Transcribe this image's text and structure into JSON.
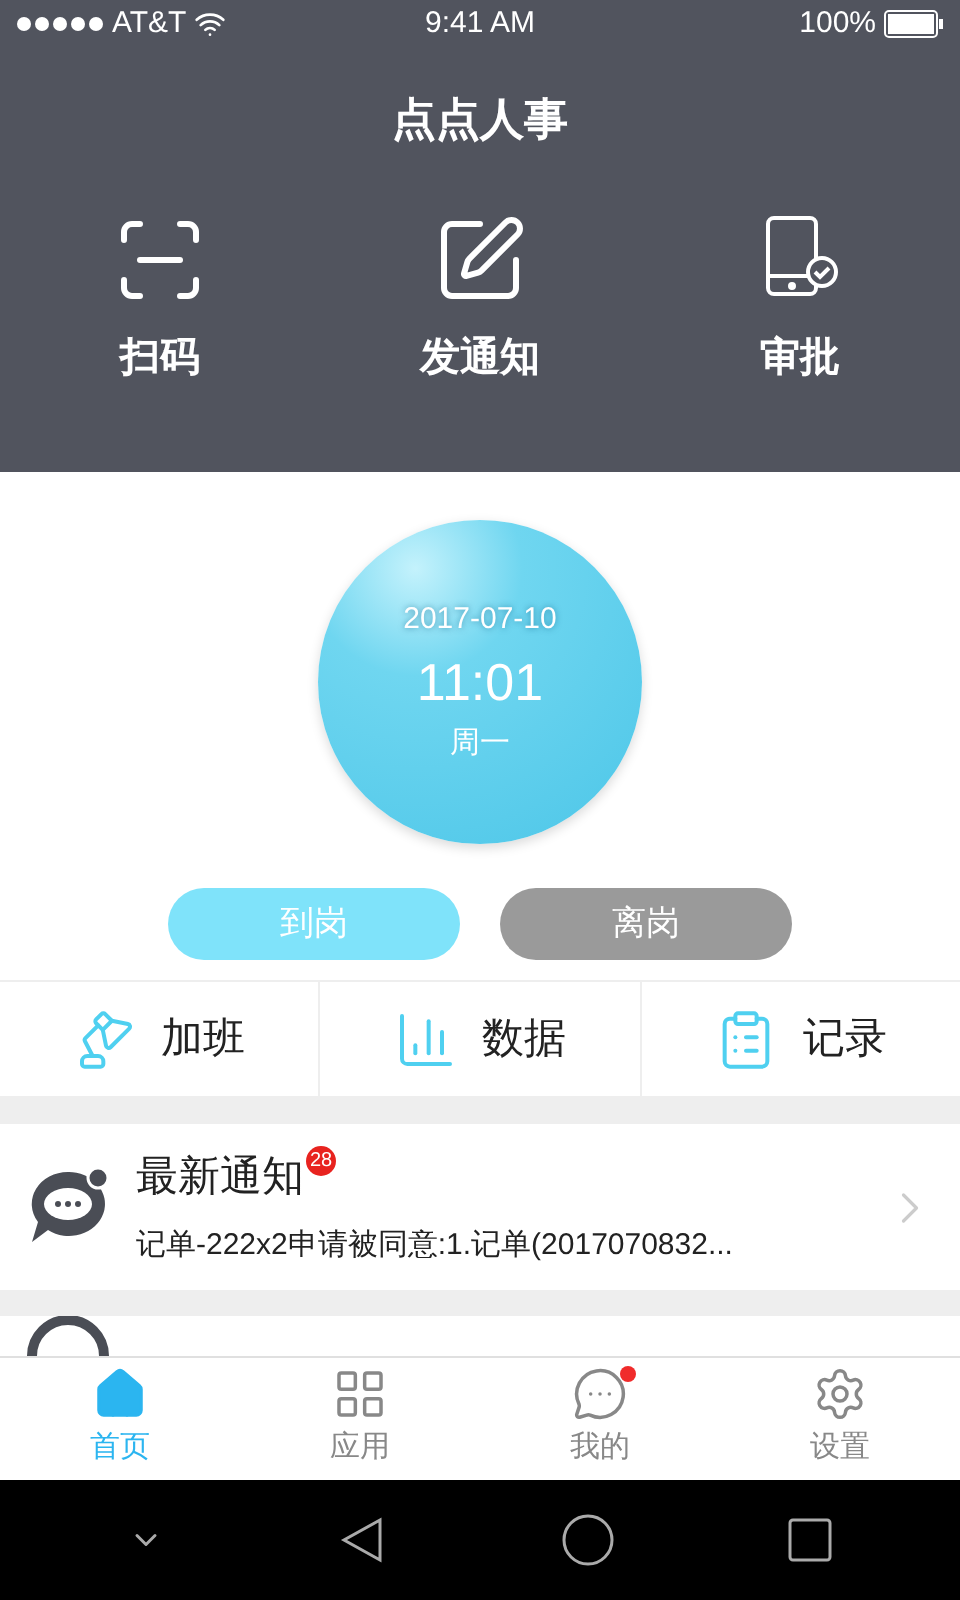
{
  "status_bar": {
    "carrier": "AT&T",
    "time": "9:41 AM",
    "battery": "100%"
  },
  "header": {
    "title": "点点人事",
    "actions": [
      {
        "label": "扫码",
        "kind": "scan"
      },
      {
        "label": "发通知",
        "kind": "compose"
      },
      {
        "label": "审批",
        "kind": "approve"
      }
    ]
  },
  "clock": {
    "date": "2017-07-10",
    "time": "11:01",
    "weekday": "周一"
  },
  "buttons": [
    {
      "label": "到岗",
      "disabled": false
    },
    {
      "label": "离岗",
      "disabled": true
    }
  ],
  "shortcuts": [
    {
      "label": "加班",
      "kind": "lamp"
    },
    {
      "label": "数据",
      "kind": "chart"
    },
    {
      "label": "记录",
      "kind": "clipboard"
    }
  ],
  "notification": {
    "title": "最新通知",
    "badge": "28",
    "text": "记单-222x2申请被同意:1.记单(2017070832..."
  },
  "tabs": [
    {
      "label": "首页",
      "kind": "home",
      "selected": true,
      "dot": false
    },
    {
      "label": "应用",
      "kind": "apps",
      "selected": false,
      "dot": false
    },
    {
      "label": "我的",
      "kind": "chat",
      "selected": false,
      "dot": true
    },
    {
      "label": "设置",
      "kind": "settings",
      "selected": false,
      "dot": false
    }
  ]
}
